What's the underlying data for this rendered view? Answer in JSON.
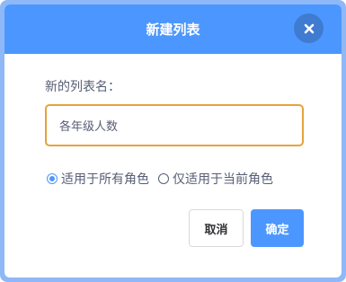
{
  "dialog": {
    "title": "新建列表",
    "close_icon": "close-icon"
  },
  "form": {
    "name_label": "新的列表名：",
    "name_value": "各年级人数"
  },
  "scope": {
    "selected": "all_roles",
    "options": [
      {
        "id": "all_roles",
        "label": "适用于所有角色"
      },
      {
        "id": "current_role",
        "label": "仅适用于当前角色"
      }
    ]
  },
  "buttons": {
    "cancel_label": "取消",
    "confirm_label": "确定"
  },
  "colors": {
    "accent": "#4c97ff",
    "input_focus_border": "#e6a23c",
    "text": "#575e75"
  }
}
